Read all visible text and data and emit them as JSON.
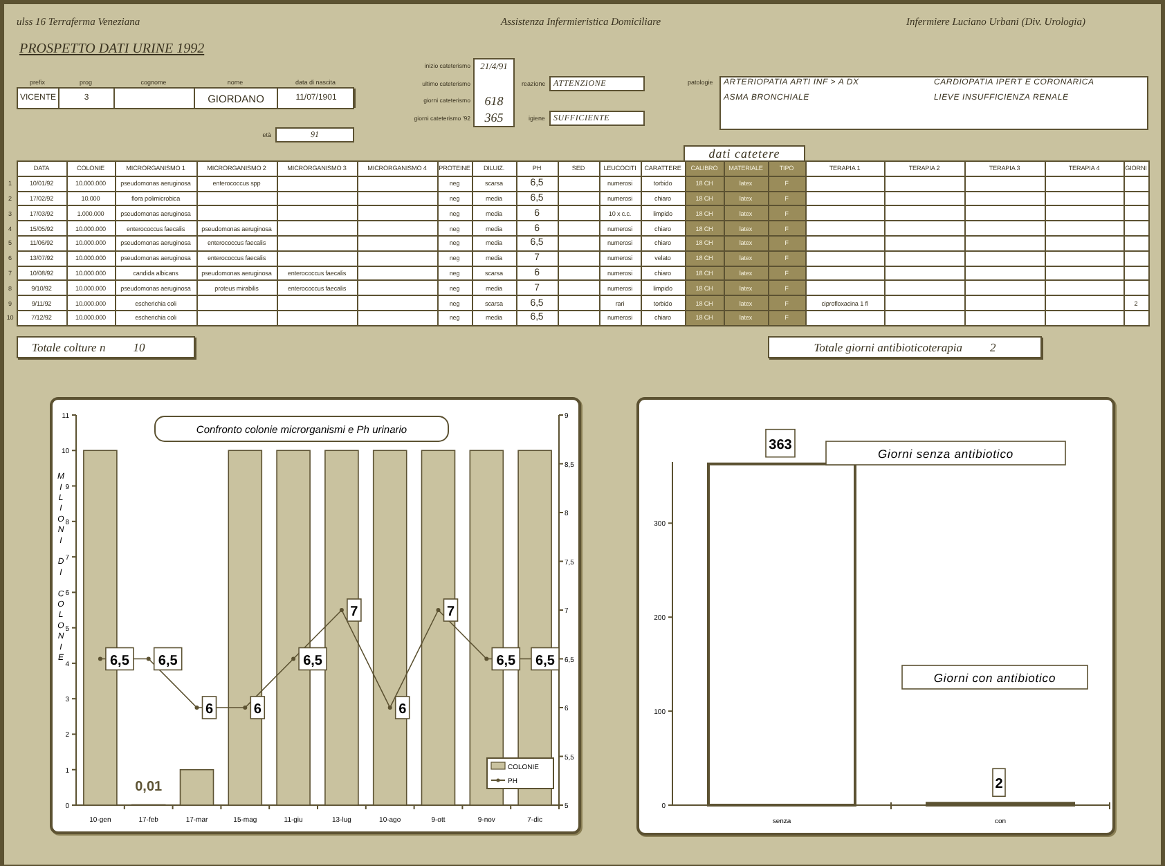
{
  "header": {
    "left": "ulss 16 Terraferma Veneziana",
    "center": "Assistenza Infermieristica Domiciliare",
    "right": "Infermiere Luciano Urbani (Div. Urologia)"
  },
  "title": "PROSPETTO  DATI  URINE  1992",
  "patient": {
    "fields": [
      {
        "label": "prefix",
        "value": "VICENTE"
      },
      {
        "label": "prog",
        "value": "3"
      },
      {
        "label": "cognome"
      },
      {
        "label": "nome",
        "value": "GIORDANO"
      },
      {
        "label": "data di nascita",
        "value": "11/07/1901"
      }
    ],
    "age": {
      "label": "età",
      "value": "91"
    }
  },
  "catheterization": [
    {
      "label": "inizio cateterismo",
      "value": "21/4/91"
    },
    {
      "label": "ultimo cateterismo"
    },
    {
      "label": "giorni cateterismo",
      "value": "618"
    },
    {
      "label": "giorni cateterismo '92",
      "value": "365"
    }
  ],
  "status": [
    {
      "label": "reazione",
      "value": "ATTENZIONE"
    },
    {
      "label": "igiene",
      "value": "SUFFICIENTE"
    }
  ],
  "pathologies": {
    "label": "patologie",
    "items": [
      "ARTERIOPATIA ARTI INF > A DX",
      "CARDIOPATIA IPERT E CORONARICA",
      "ASMA BRONCHIALE",
      "LIEVE INSUFFICIENZA RENALE"
    ]
  },
  "catheter_group": "dati catetere",
  "table": {
    "columns": [
      {
        "label": "DATA",
        "kind": "plain"
      },
      {
        "label": "COLONIE",
        "kind": "plain"
      },
      {
        "label": "MICRORGANISMO 1",
        "kind": "plain"
      },
      {
        "label": "MICRORGANISMO 2",
        "kind": "plain"
      },
      {
        "label": "MICRORGANISMO 3",
        "kind": "plain"
      },
      {
        "label": "MICRORGANISMO 4",
        "kind": "plain"
      },
      {
        "label": "PROTEINE",
        "kind": "plain"
      },
      {
        "label": "DILUIZ.",
        "kind": "plain"
      },
      {
        "label": "PH",
        "kind": "plain"
      },
      {
        "label": "SED",
        "kind": "plain"
      },
      {
        "label": "LEUCOCITI",
        "kind": "plain"
      },
      {
        "label": "CARATTERE",
        "kind": "plain"
      },
      {
        "label": "CALIBRO",
        "kind": "catheter"
      },
      {
        "label": "MATERIALE",
        "kind": "catheter"
      },
      {
        "label": "TIPO",
        "kind": "catheter"
      },
      {
        "label": "TERAPIA 1",
        "kind": "plain"
      },
      {
        "label": "TERAPIA 2",
        "kind": "plain"
      },
      {
        "label": "TERAPIA 3",
        "kind": "plain"
      },
      {
        "label": "TERAPIA 4",
        "kind": "plain"
      },
      {
        "label": "GIORNI",
        "kind": "plain"
      }
    ],
    "rows": [
      {
        "number": "1",
        "cells": [
          "10/01/92",
          "10.000.000",
          "pseudomonas aeruginosa",
          "enterococcus spp",
          null,
          null,
          "neg",
          "scarsa",
          "6,5",
          null,
          "numerosi",
          "torbido",
          "18 CH",
          "latex",
          "F",
          null,
          null,
          null,
          null,
          null
        ]
      },
      {
        "number": "2",
        "cells": [
          "17/02/92",
          "10.000",
          "flora polimicrobica",
          null,
          null,
          null,
          "neg",
          "media",
          "6,5",
          null,
          "numerosi",
          "chiaro",
          "18 CH",
          "latex",
          "F",
          null,
          null,
          null,
          null,
          null
        ]
      },
      {
        "number": "3",
        "cells": [
          "17/03/92",
          "1.000.000",
          "pseudomonas aeruginosa",
          null,
          null,
          null,
          "neg",
          "media",
          "6",
          null,
          "10 x c.c.",
          "limpido",
          "18 CH",
          "latex",
          "F",
          null,
          null,
          null,
          null,
          null
        ]
      },
      {
        "number": "4",
        "cells": [
          "15/05/92",
          "10.000.000",
          "enterococcus faecalis",
          "pseudomonas aeruginosa",
          null,
          null,
          "neg",
          "media",
          "6",
          null,
          "numerosi",
          "chiaro",
          "18 CH",
          "latex",
          "F",
          null,
          null,
          null,
          null,
          null
        ]
      },
      {
        "number": "5",
        "cells": [
          "11/06/92",
          "10.000.000",
          "pseudomonas aeruginosa",
          "enterococcus faecalis",
          null,
          null,
          "neg",
          "media",
          "6,5",
          null,
          "numerosi",
          "chiaro",
          "18 CH",
          "latex",
          "F",
          null,
          null,
          null,
          null,
          null
        ]
      },
      {
        "number": "6",
        "cells": [
          "13/07/92",
          "10.000.000",
          "pseudomonas aeruginosa",
          "enterococcus faecalis",
          null,
          null,
          "neg",
          "media",
          "7",
          null,
          "numerosi",
          "velato",
          "18 CH",
          "latex",
          "F",
          null,
          null,
          null,
          null,
          null
        ]
      },
      {
        "number": "7",
        "cells": [
          "10/08/92",
          "10.000.000",
          "candida albicans",
          "pseudomonas aeruginosa",
          "enterococcus faecalis",
          null,
          "neg",
          "scarsa",
          "6",
          null,
          "numerosi",
          "chiaro",
          "18 CH",
          "latex",
          "F",
          null,
          null,
          null,
          null,
          null
        ]
      },
      {
        "number": "8",
        "cells": [
          "9/10/92",
          "10.000.000",
          "pseudomonas aeruginosa",
          "proteus mirabilis",
          "enterococcus faecalis",
          null,
          "neg",
          "media",
          "7",
          null,
          "numerosi",
          "limpido",
          "18 CH",
          "latex",
          "F",
          null,
          null,
          null,
          null,
          null
        ]
      },
      {
        "number": "9",
        "cells": [
          "9/11/92",
          "10.000.000",
          "escherichia coli",
          null,
          null,
          null,
          "neg",
          "scarsa",
          "6,5",
          null,
          "rari",
          "torbido",
          "18 CH",
          "latex",
          "F",
          "ciprofloxacina 1 fl",
          null,
          null,
          null,
          "2"
        ]
      },
      {
        "number": "10",
        "cells": [
          "7/12/92",
          "10.000.000",
          "escherichia coli",
          null,
          null,
          null,
          "neg",
          "media",
          "6,5",
          null,
          "numerosi",
          "chiaro",
          "18 CH",
          "latex",
          "F",
          null,
          null,
          null,
          null,
          null
        ]
      }
    ]
  },
  "totals": [
    {
      "label": "Totale colture n",
      "value": "10"
    },
    {
      "label": "Totale giorni antibioticoterapia",
      "value": "2"
    }
  ],
  "colonies_chart": {
    "chart_data": {
      "type": "bar",
      "title": "Confronto colonie microrganismi e Ph urinario",
      "ylabel": "MILIONI DI COLONIE",
      "categories": [
        "10-gen",
        "17-feb",
        "17-mar",
        "15-mag",
        "11-giu",
        "13-lug",
        "10-ago",
        "9-ott",
        "9-nov",
        "7-dic"
      ],
      "series": [
        {
          "name": "COLONIE",
          "color": "#c9c29f",
          "values": [
            10,
            0.01,
            1,
            10,
            10,
            10,
            10,
            10,
            10,
            10
          ]
        }
      ],
      "ylim": [
        0,
        11
      ],
      "yticks": [
        0,
        1,
        2,
        3,
        4,
        5,
        6,
        7,
        8,
        9,
        10,
        11
      ],
      "value_labels": [
        null,
        "0,01",
        null,
        null,
        null,
        null,
        null,
        null,
        null,
        null
      ]
    }
  },
  "ph_chart": {
    "chart_data": {
      "type": "line",
      "series": [
        {
          "name": "PH",
          "color": "#5c5232",
          "marker": "circle",
          "values": [
            6.5,
            6.5,
            6,
            6,
            6.5,
            7,
            6,
            7,
            6.5,
            6.5
          ]
        }
      ],
      "ylim": [
        5,
        9
      ],
      "yticks": [
        5,
        {
          "value": 5.5,
          "label": "5,5"
        },
        6,
        {
          "value": 6.5,
          "label": "6,5"
        },
        7,
        {
          "value": 7.5,
          "label": "7,5"
        },
        8,
        {
          "value": 8.5,
          "label": "8,5"
        },
        9
      ],
      "value_labels": [
        "6,5",
        "6,5",
        "6",
        "6",
        "6,5",
        "7",
        "6",
        "7",
        "6,5",
        "6,5"
      ]
    }
  },
  "antibiotic_chart": {
    "chart_data": {
      "type": "bar",
      "categories": [
        "senza",
        "con"
      ],
      "series": [
        {
          "color": "#ffffff",
          "values": [
            363,
            2
          ]
        }
      ],
      "ylim": [
        0,
        365
      ],
      "yticks": [
        0,
        100,
        200,
        300
      ],
      "value_labels": [
        "363",
        "2"
      ],
      "annotations": [
        "Giorni senza antibiotico",
        "Giorni con antibiotico"
      ]
    }
  }
}
